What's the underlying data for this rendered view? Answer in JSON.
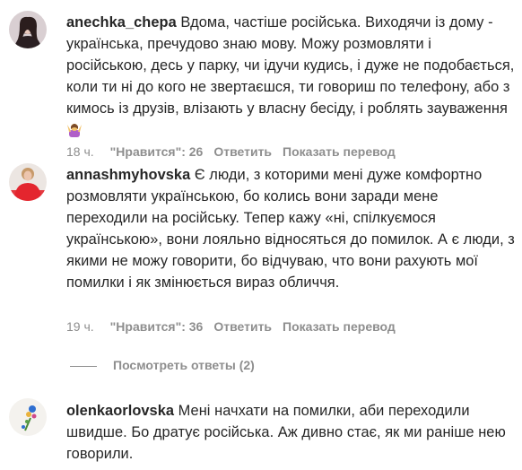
{
  "comments": [
    {
      "username": "anechka_chepa",
      "text": "Вдома, частіше російська. Виходячи із дому - українська, пречудово знаю мову. Можу розмовляти і російською, десь у парку, чи ідучи кудись, і дуже не подобається, коли ти ні до кого не звертаєшся, ти говориш по телефону, або з кимось із друзів, влізають у власну бесіду, і роблять зауваження",
      "time": "18 ч.",
      "likes": "\"Нравится\": 26",
      "reply": "Ответить",
      "translate": "Показать перевод"
    },
    {
      "username": "annashmyhovska",
      "text": "Є люди, з которими мені дуже комфортно розмовляти українською, бо колись вони заради мене переходили на російську. Тепер кажу «ні, спілкуємося українською», вони лояльно відносяться до помилок. А є люди, з якими не можу говорити, бо відчуваю, что вони рахують мої помилки і як змінюється вираз обличчя.",
      "time": "19 ч.",
      "likes": "\"Нравится\": 36",
      "reply": "Ответить",
      "translate": "Показать перевод"
    },
    {
      "username": "olenkaorlovska",
      "text": "Мені начхати на помилки, аби переходили швидше. Бо дратує російська. Аж дивно стає, як ми раніше нею говорили."
    }
  ],
  "view_replies": "Посмотреть ответы (2)",
  "icons": {
    "emoji": "woman-shrugging-emoji"
  }
}
